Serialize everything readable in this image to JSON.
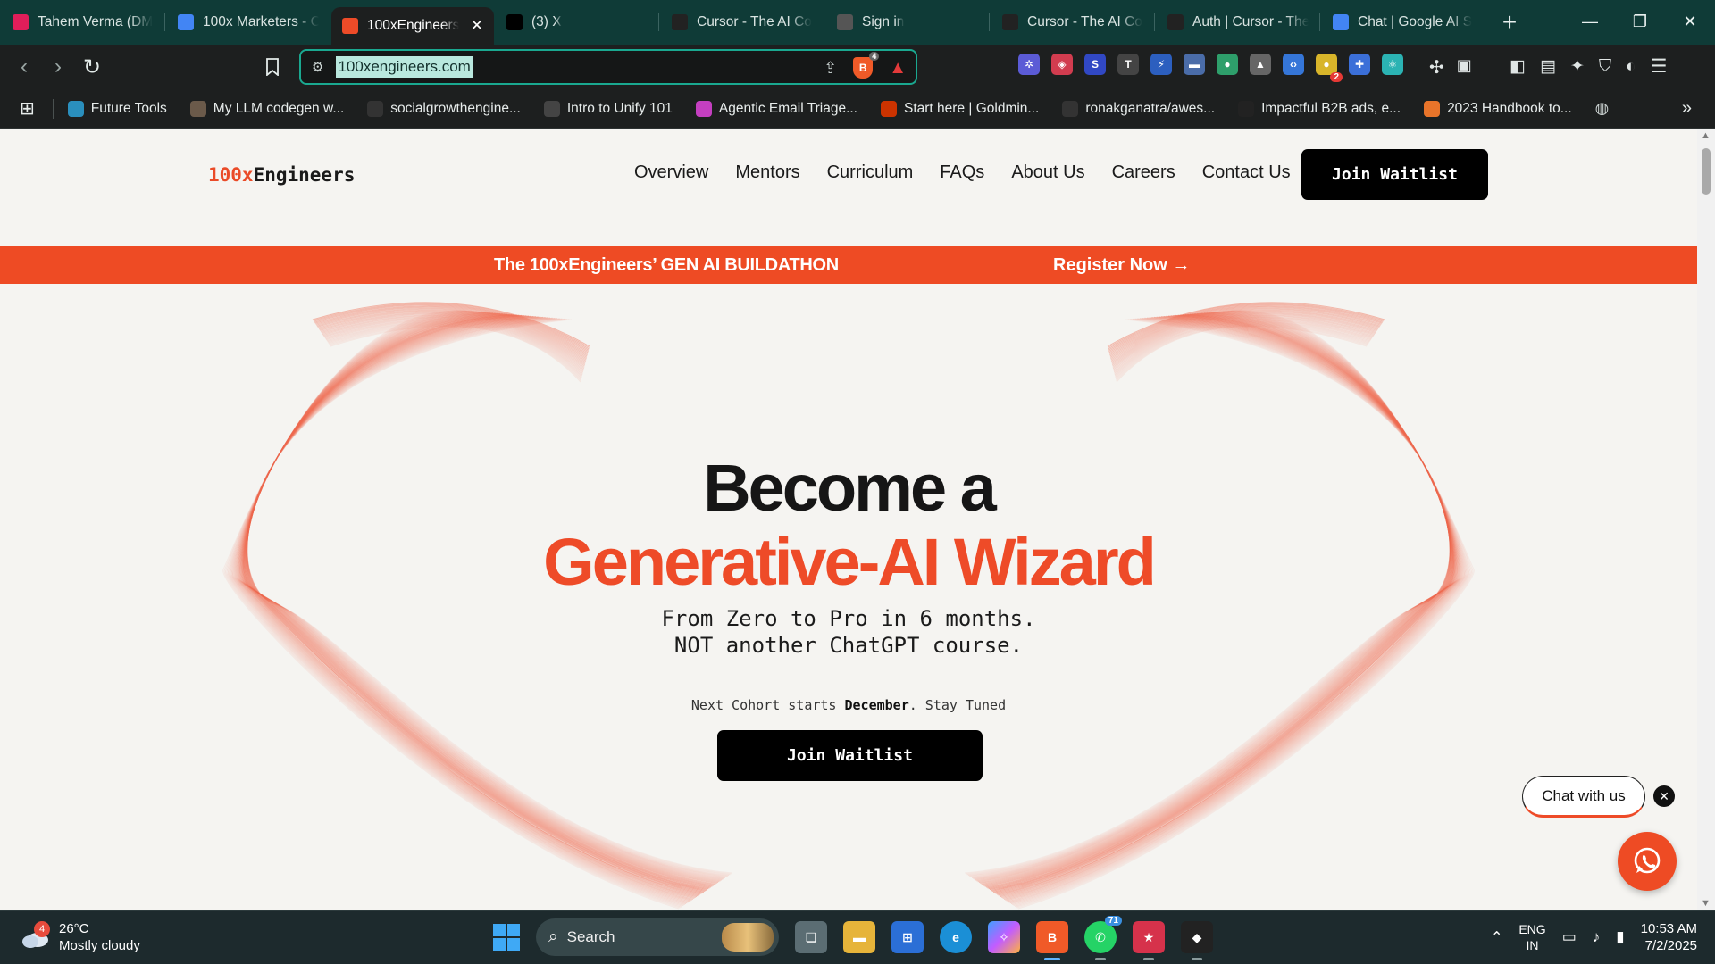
{
  "browser": {
    "tabs": [
      {
        "title": "Tahem Verma (DM",
        "icon": "slack-icon",
        "color": "#e01e5a"
      },
      {
        "title": "100x Marketers - C",
        "icon": "docs-icon",
        "color": "#4285f4"
      },
      {
        "title": "100xEngineers",
        "icon": "100x-icon",
        "color": "#ee4b28",
        "active": true
      },
      {
        "title": "(3) X",
        "icon": "x-icon",
        "color": "#000000"
      },
      {
        "title": "Cursor - The AI Co",
        "icon": "cursor-icon",
        "color": "#222222"
      },
      {
        "title": "Sign in",
        "icon": "globe-icon",
        "color": "#555555"
      },
      {
        "title": "Cursor - The AI Co",
        "icon": "cursor-icon",
        "color": "#222222"
      },
      {
        "title": "Auth | Cursor - The",
        "icon": "cursor-icon",
        "color": "#222222"
      },
      {
        "title": "Chat | Google AI S",
        "icon": "google-ai-icon",
        "color": "#4285f4"
      }
    ],
    "url": "100xengineers.com",
    "shield_badge": "4",
    "extensions": [
      {
        "name": "ext-1-icon",
        "color": "#5b5bd6",
        "glyph": "✲"
      },
      {
        "name": "ext-2-icon",
        "color": "#d23c4f",
        "glyph": "◈"
      },
      {
        "name": "ext-3-icon",
        "color": "#3148c4",
        "glyph": "S"
      },
      {
        "name": "ext-4-icon",
        "color": "#444444",
        "glyph": "T"
      },
      {
        "name": "ext-5-icon",
        "color": "#2c5fbf",
        "glyph": "⚡"
      },
      {
        "name": "ext-6-icon",
        "color": "#4a6ca8",
        "glyph": "▬"
      },
      {
        "name": "ext-7-icon",
        "color": "#2e9f6b",
        "glyph": "●"
      },
      {
        "name": "ext-8-icon",
        "color": "#666666",
        "glyph": "▲"
      },
      {
        "name": "ext-9-icon",
        "color": "#3576d8",
        "glyph": "‹›"
      },
      {
        "name": "ext-10-icon",
        "color": "#d8b52a",
        "glyph": "●",
        "badge": "2"
      },
      {
        "name": "ext-11-icon",
        "color": "#3b6fd8",
        "glyph": "✚"
      },
      {
        "name": "ext-12-icon",
        "color": "#2bb3b3",
        "glyph": "⚛"
      }
    ]
  },
  "bookmarks": [
    {
      "label": "Future Tools",
      "color": "#2a8fbd"
    },
    {
      "label": "My LLM codegen w...",
      "color": "#6b5a4a"
    },
    {
      "label": "socialgrowthengine...",
      "color": "#333333"
    },
    {
      "label": "Intro to Unify 101",
      "color": "#444444"
    },
    {
      "label": "Agentic Email Triage...",
      "color": "#c43fc0"
    },
    {
      "label": "Start here | Goldmin...",
      "color": "#cc3300"
    },
    {
      "label": "ronakganatra/awes...",
      "color": "#333333"
    },
    {
      "label": "Impactful B2B ads, e...",
      "color": "#222222"
    },
    {
      "label": "2023 Handbook to...",
      "color": "#e8742a"
    }
  ],
  "site": {
    "logo_prefix": "100x",
    "logo_suffix": "Engineers",
    "nav": [
      "Overview",
      "Mentors",
      "Curriculum",
      "FAQs",
      "About Us",
      "Careers",
      "Contact Us"
    ],
    "header_cta": "Join Waitlist",
    "banner_text": "The 100xEngineers’ GEN AI BUILDATHON",
    "banner_cta": "Register Now",
    "hero_line1": "Become a",
    "hero_line2": "Generative-AI Wizard",
    "sub_line1": "From Zero to Pro in 6 months.",
    "sub_line2": "NOT another ChatGPT course.",
    "cohort_prefix": "Next Cohort starts",
    "cohort_month": "December",
    "cohort_suffix": ". Stay Tuned",
    "hero_cta": "Join Waitlist",
    "chat_label": "Chat with us",
    "accent": "#ee4b28"
  },
  "taskbar": {
    "weather_badge": "4",
    "temperature": "26°C",
    "condition": "Mostly cloudy",
    "search_placeholder": "Search",
    "whatsapp_badge": "71",
    "lang_top": "ENG",
    "lang_bottom": "IN",
    "time": "10:53 AM",
    "date": "7/2/2025"
  }
}
